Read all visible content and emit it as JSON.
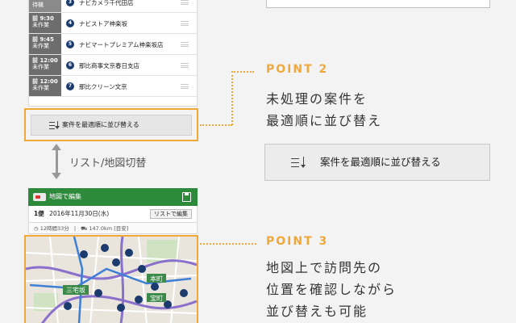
{
  "list": {
    "rows": [
      {
        "status": "待機",
        "time": "",
        "num": "3",
        "name": "ナビカメラ千代田店",
        "first": true
      },
      {
        "status": "未作業",
        "time": "9:30",
        "num": "4",
        "name": "ナビストア神楽坂"
      },
      {
        "status": "未作業",
        "time": "9:45",
        "num": "5",
        "name": "ナビマートプレミアム神楽坂店"
      },
      {
        "status": "未作業",
        "time": "12:00",
        "num": "6",
        "name": "那比商事文京春日支店"
      },
      {
        "status": "未作業",
        "time": "12:00",
        "num": "7",
        "name": "那比クリーン文京"
      }
    ],
    "sort_button_label": "案件を最適順に並び替える"
  },
  "toggle": {
    "label": "リスト/地図切替"
  },
  "map_screen": {
    "header_title": "地図で編集",
    "bin_label": "1便",
    "date_label": "2016年11月30日(水)",
    "list_edit_button": "リストで編集",
    "duration": "12時間33分",
    "distance": "147.0km",
    "distance_note": "[目安]",
    "map_labels": [
      "三宅坂",
      "本町",
      "宝町"
    ]
  },
  "points": [
    {
      "title": "POINT 2",
      "lines": [
        "未処理の案件を",
        "最適順に並び替え"
      ]
    },
    {
      "title": "POINT 3",
      "lines": [
        "地図上で訪問先の",
        "位置を確認しながら",
        "並び替えも可能"
      ]
    }
  ],
  "large_sort_button": {
    "label": "案件を最適順に並び替える"
  },
  "colors": {
    "accent": "#f0a838",
    "header_green": "#2c8a3a",
    "pin_navy": "#1b3b6f"
  }
}
